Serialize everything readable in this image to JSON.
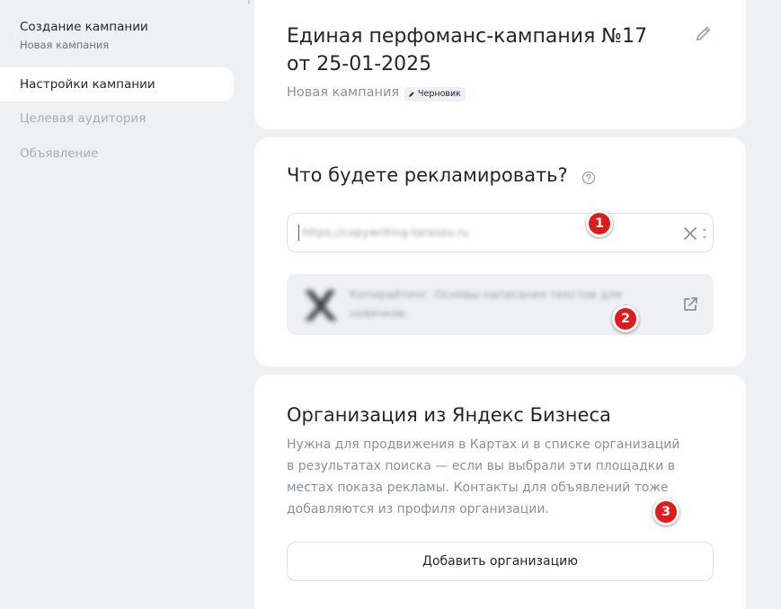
{
  "sidebar": {
    "title": "Создание кампании",
    "subtitle": "Новая кампания",
    "items": [
      {
        "label": "Настройки кампании",
        "active": true
      },
      {
        "label": "Целевая аудитория",
        "active": false
      },
      {
        "label": "Объявление",
        "active": false
      }
    ]
  },
  "campaign": {
    "title": "Единая перфоманс-кампания №17 от 25-01-2025",
    "subtitle": "Новая кампания",
    "badge": "Черновик",
    "edit_icon": "pencil-icon"
  },
  "advertise": {
    "title": "Что будете рекламировать?",
    "help_icon": "question-circle-icon",
    "url_value": "https://copywriting-tarasov.ru",
    "clear_icon": "close-icon",
    "preview_text": "Копирайтинг. Основы написания текстов для новичков.",
    "open_icon": "external-link-icon"
  },
  "organization": {
    "title": "Организация из Яндекс Бизнеса",
    "description": "Нужна для продвижения в Картах и в списке организаций в результатах поиска — если вы выбрали эти площадки в местах показа рекламы. Контакты для объявлений тоже добавляются из профиля организации.",
    "button_label": "Добавить организацию"
  },
  "markers": [
    "1",
    "2",
    "3"
  ],
  "colors": {
    "background": "#eef0f4",
    "card": "#ffffff",
    "marker": "#e11a1a",
    "muted_text": "#8b919c"
  }
}
